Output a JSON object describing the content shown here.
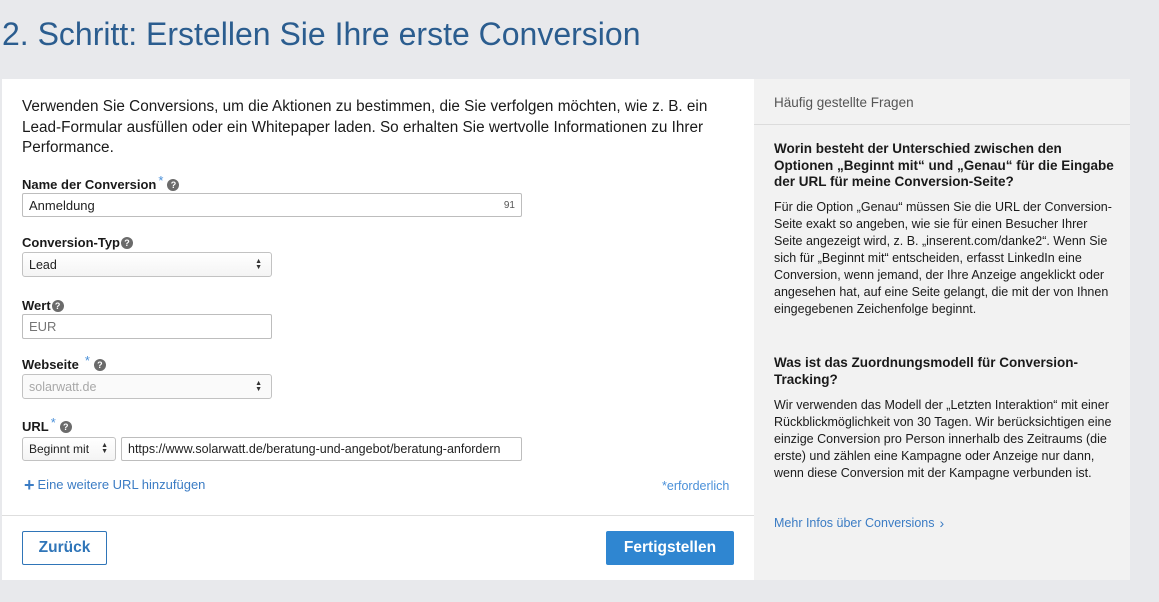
{
  "page_title": "2. Schritt: Erstellen Sie Ihre erste Conversion",
  "intro": "Verwenden Sie Conversions, um die Aktionen zu bestimmen, die Sie verfolgen möchten, wie z. B. ein Lead-Formular ausfüllen oder ein Whitepaper laden. So erhalten Sie wertvolle Informationen zu Ihrer Performance.",
  "fields": {
    "name": {
      "label": "Name der Conversion",
      "value": "Anmeldung",
      "counter": "91"
    },
    "type": {
      "label": "Conversion-Typ",
      "value": "Lead"
    },
    "value": {
      "label": "Wert",
      "placeholder": "EUR"
    },
    "website": {
      "label": "Webseite",
      "value": "solarwatt.de"
    },
    "url": {
      "label": "URL",
      "match": "Beginnt mit",
      "value": "https://www.solarwatt.de/beratung-und-angebot/beratung-anfordern"
    }
  },
  "required_mark": "*",
  "help_symbol": "?",
  "add_url": {
    "plus": "+",
    "label": "Eine weitere URL hinzufügen"
  },
  "required_note": "*erforderlich",
  "buttons": {
    "back": "Zurück",
    "finish": "Fertigstellen"
  },
  "faq": {
    "header": "Häufig gestellte Fragen",
    "items": [
      {
        "question": "Worin besteht der Unterschied zwischen den Optionen „Beginnt mit“ und „Genau“ für die Eingabe der URL für meine Conversion-Seite?",
        "answer": "Für die Option „Genau“ müssen Sie die URL der Conversion-Seite exakt so angeben, wie sie für einen Besucher Ihrer Seite angezeigt wird, z. B. „inserent.com/danke2“. Wenn Sie sich für „Beginnt mit“ entscheiden, erfasst LinkedIn eine Conversion, wenn jemand, der Ihre Anzeige angeklickt oder angesehen hat, auf eine Seite gelangt, die mit der von Ihnen eingegebenen Zeichenfolge beginnt."
      },
      {
        "question": "Was ist das Zuordnungsmodell für Conversion-Tracking?",
        "answer": "Wir verwenden das Modell der „Letzten Interaktion“ mit einer Rückblickmöglichkeit von 30 Tagen. Wir berücksichtigen eine einzige Conversion pro Person innerhalb des Zeitraums (die erste) und zählen eine Kampagne oder Anzeige nur dann, wenn diese Conversion mit der Kampagne verbunden ist."
      }
    ],
    "more_link": "Mehr Infos über Conversions",
    "more_chevron": "›"
  },
  "colors": {
    "title": "#2b5d8f",
    "primary": "#2f86d1",
    "link": "#3b7cc4",
    "background": "#e8e9ec"
  },
  "icons": [
    "help-icon",
    "select-arrows-icon",
    "plus-icon",
    "chevron-right-icon"
  ]
}
